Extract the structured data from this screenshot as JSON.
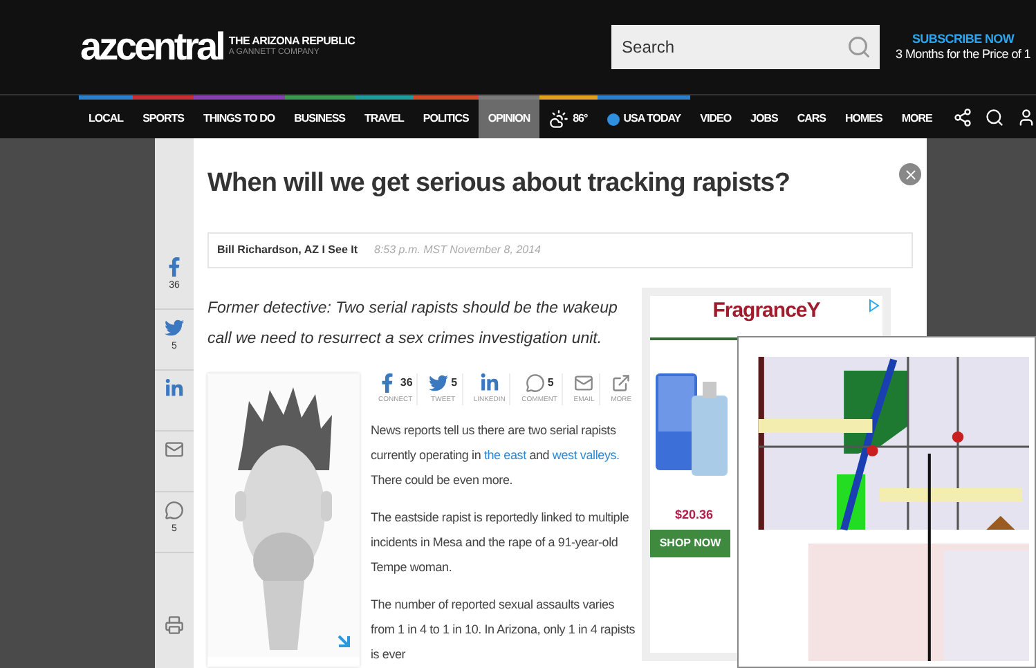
{
  "header": {
    "logo": "azcentral",
    "publisher": "THE ARIZONA REPUBLIC",
    "company": "A GANNETT COMPANY",
    "search": {
      "placeholder": "Search"
    },
    "subscribe": {
      "title": "SUBSCRIBE NOW",
      "subtitle": "3 Months for the Price of 1"
    }
  },
  "nav": {
    "items": [
      {
        "kind": "text",
        "label": "LOCAL",
        "color": "#2f7fc8",
        "selected": false
      },
      {
        "kind": "text",
        "label": "SPORTS",
        "color": "#c8302f",
        "selected": false
      },
      {
        "kind": "text",
        "label": "THINGS TO DO",
        "color": "#8a3fb0",
        "selected": false
      },
      {
        "kind": "text",
        "label": "BUSINESS",
        "color": "#3d9a4a",
        "selected": false
      },
      {
        "kind": "text",
        "label": "TRAVEL",
        "color": "#1f9aa0",
        "selected": false
      },
      {
        "kind": "text",
        "label": "POLITICS",
        "color": "#d04a2a",
        "selected": false
      },
      {
        "kind": "text",
        "label": "OPINION",
        "color": "#7a7a7a",
        "selected": true
      },
      {
        "kind": "weather",
        "label": "86°",
        "color": "#e0a020",
        "selected": false
      },
      {
        "kind": "usatoday",
        "label": "USA TODAY",
        "color": "#2f7fc8",
        "selected": false
      },
      {
        "kind": "text",
        "label": "VIDEO",
        "color": "#111111",
        "selected": false
      },
      {
        "kind": "text",
        "label": "JOBS",
        "color": "#111111",
        "selected": false
      },
      {
        "kind": "text",
        "label": "CARS",
        "color": "#111111",
        "selected": false
      },
      {
        "kind": "text",
        "label": "HOMES",
        "color": "#111111",
        "selected": false
      },
      {
        "kind": "text",
        "label": "MORE",
        "color": "#111111",
        "selected": false
      }
    ]
  },
  "rail": [
    {
      "kind": "facebook",
      "count": "36"
    },
    {
      "kind": "twitter",
      "count": "5"
    },
    {
      "kind": "linkedin"
    },
    {
      "kind": "email"
    },
    {
      "kind": "comment",
      "count": "5"
    },
    {
      "kind": "print"
    }
  ],
  "article": {
    "title": "When will we get serious about tracking rapists?",
    "author": "Bill Richardson, AZ I See It",
    "date": "8:53 p.m. MST November 8, 2014",
    "dek": "Former detective: Two serial rapists should be the wakeup call we need to resurrect a sex crimes investigation unit.",
    "share": [
      {
        "kind": "facebook",
        "count": "36",
        "label": "CONNECT"
      },
      {
        "kind": "twitter",
        "count": "5",
        "label": "TWEET"
      },
      {
        "kind": "linkedin",
        "label": "LINKEDIN"
      },
      {
        "kind": "comment",
        "count": "5",
        "label": "COMMENT"
      },
      {
        "kind": "email",
        "label": "EMAIL"
      },
      {
        "kind": "more",
        "label": "MORE"
      }
    ],
    "paragraphs": [
      [
        {
          "text": "News reports tell us there are two serial rapists currently operating in ",
          "link": false
        },
        {
          "text": "the east",
          "link": true
        },
        {
          "text": " and ",
          "link": false
        },
        {
          "text": "west valleys.",
          "link": true
        },
        {
          "text": " There could be even more.",
          "link": false
        }
      ],
      [
        {
          "text": "The eastside rapist is reportedly linked to multiple incidents in Mesa and the rape of a 91-year-old Tempe woman.",
          "link": false
        }
      ],
      [
        {
          "text": "The number of reported sexual assaults varies from 1 in 4 to 1 in 10. In Arizona, only 1 in 4 rapists is ever",
          "link": false
        }
      ]
    ]
  },
  "ad": {
    "brand": "FragranceY",
    "price": "$20.36",
    "button": "SHOP NOW"
  }
}
